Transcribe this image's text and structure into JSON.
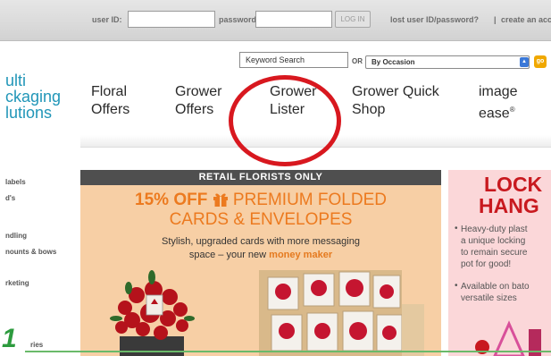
{
  "login": {
    "user_id_label": "user ID:",
    "password_label": "password:",
    "login_button": "LOG IN",
    "lost_link": "lost user ID/password?",
    "divider": "|",
    "create_link": "create an acc"
  },
  "search": {
    "keyword_placeholder": "Keyword Search",
    "or_label": "OR",
    "occasion_selected": "By Occasion",
    "go_label": "go"
  },
  "logo": {
    "line1": "ulti",
    "line2": "ckaging",
    "line3": "lutions"
  },
  "nav": [
    {
      "line1": "Floral",
      "line2": "Offers"
    },
    {
      "line1": "Grower",
      "line2": "Offers"
    },
    {
      "line1": "Grower",
      "line2": "Lister"
    },
    {
      "line1": "Grower Quick",
      "line2": "Shop"
    },
    {
      "line1": "image",
      "line2": "ease"
    }
  ],
  "nav_reg_mark": "®",
  "sidebar": [
    "labels",
    "d's",
    "ndling",
    "nounts & bows",
    "rketing",
    "ries"
  ],
  "banner": {
    "header": "RETAIL FLORISTS ONLY",
    "offer_pct": "15% OFF",
    "offer_rest": "PREMIUM FOLDED",
    "offer_line2": "CARDS & ENVELOPES",
    "copy_line1": "Stylish, upgraded cards with more messaging",
    "copy_line2_prefix": "space – your new",
    "copy_line2_highlight": "money maker"
  },
  "promo": {
    "title1": "LOCK",
    "title2": "HANG",
    "bullet1": [
      "Heavy-duty plast",
      "a unique locking",
      "to remain secure",
      "pot for good!"
    ],
    "bullet2": [
      "Available on bato",
      "versatile sizes"
    ]
  },
  "figure_number": "1",
  "colors": {
    "logo_blue": "#2196b8",
    "annotation_red": "#d8181f",
    "offer_orange": "#ec7a1f",
    "promo_red": "#c8191f",
    "figure_green": "#2d9b3e"
  },
  "icons": {
    "gift": "gift-icon",
    "select_arrow": "select-arrow-icon"
  }
}
